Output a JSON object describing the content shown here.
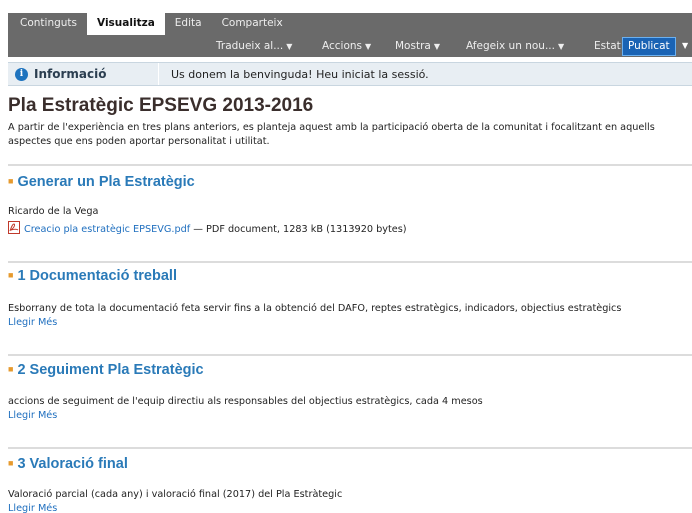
{
  "tabs": [
    "Continguts",
    "Visualitza",
    "Edita",
    "Comparteix"
  ],
  "active_tab": "Visualitza",
  "menus": [
    {
      "label": "Tradueix al...",
      "arrow": "▼"
    },
    {
      "label": "Accions",
      "arrow": "▼"
    },
    {
      "label": "Mostra",
      "arrow": "▼"
    },
    {
      "label": "Afegeix un nou...",
      "arrow": "▼"
    }
  ],
  "state": {
    "label": "Estat:",
    "value": "Publicat",
    "arrow": "▼"
  },
  "info": {
    "title": "Informació",
    "message": "Us donem la benvinguda! Heu iniciat la sessió."
  },
  "page": {
    "title": "Pla Estratègic EPSEVG 2013-2016",
    "description": "A partir de l'experiència en tres plans anteriors, es planteja aquest amb la participació oberta de la comunitat i focalitzant en aquells aspectes que ens poden aportar personalitat i utilitat."
  },
  "sections": [
    {
      "title": "Generar un Pla Estratègic",
      "author": "Ricardo de la Vega",
      "file_link": "Creacio pla estratègic EPSEVG.pdf",
      "file_info": " — PDF document, 1283 kB (1313920 bytes)"
    },
    {
      "title": "1 Documentació treball",
      "text": "Esborrany de tota la documentació feta servir fins a la obtenció del DAFO, reptes estratègics, indicadors, objectius estratègics",
      "more": "Llegir Més"
    },
    {
      "title": "2 Seguiment Pla Estratègic",
      "text": "accions de seguiment de l'equip directiu als responsables del objectius estratègics, cada 4 mesos",
      "more": "Llegir Més"
    },
    {
      "title": "3 Valoració final",
      "text": "Valoració parcial (cada any) i valoració final (2017) del Pla Estràtegic",
      "more": "Llegir Més"
    }
  ],
  "colors": {
    "editbar": "#6a6a6a",
    "link": "#1f6fbf",
    "section_title": "#2a7ab8",
    "state": "#1a63b4"
  }
}
